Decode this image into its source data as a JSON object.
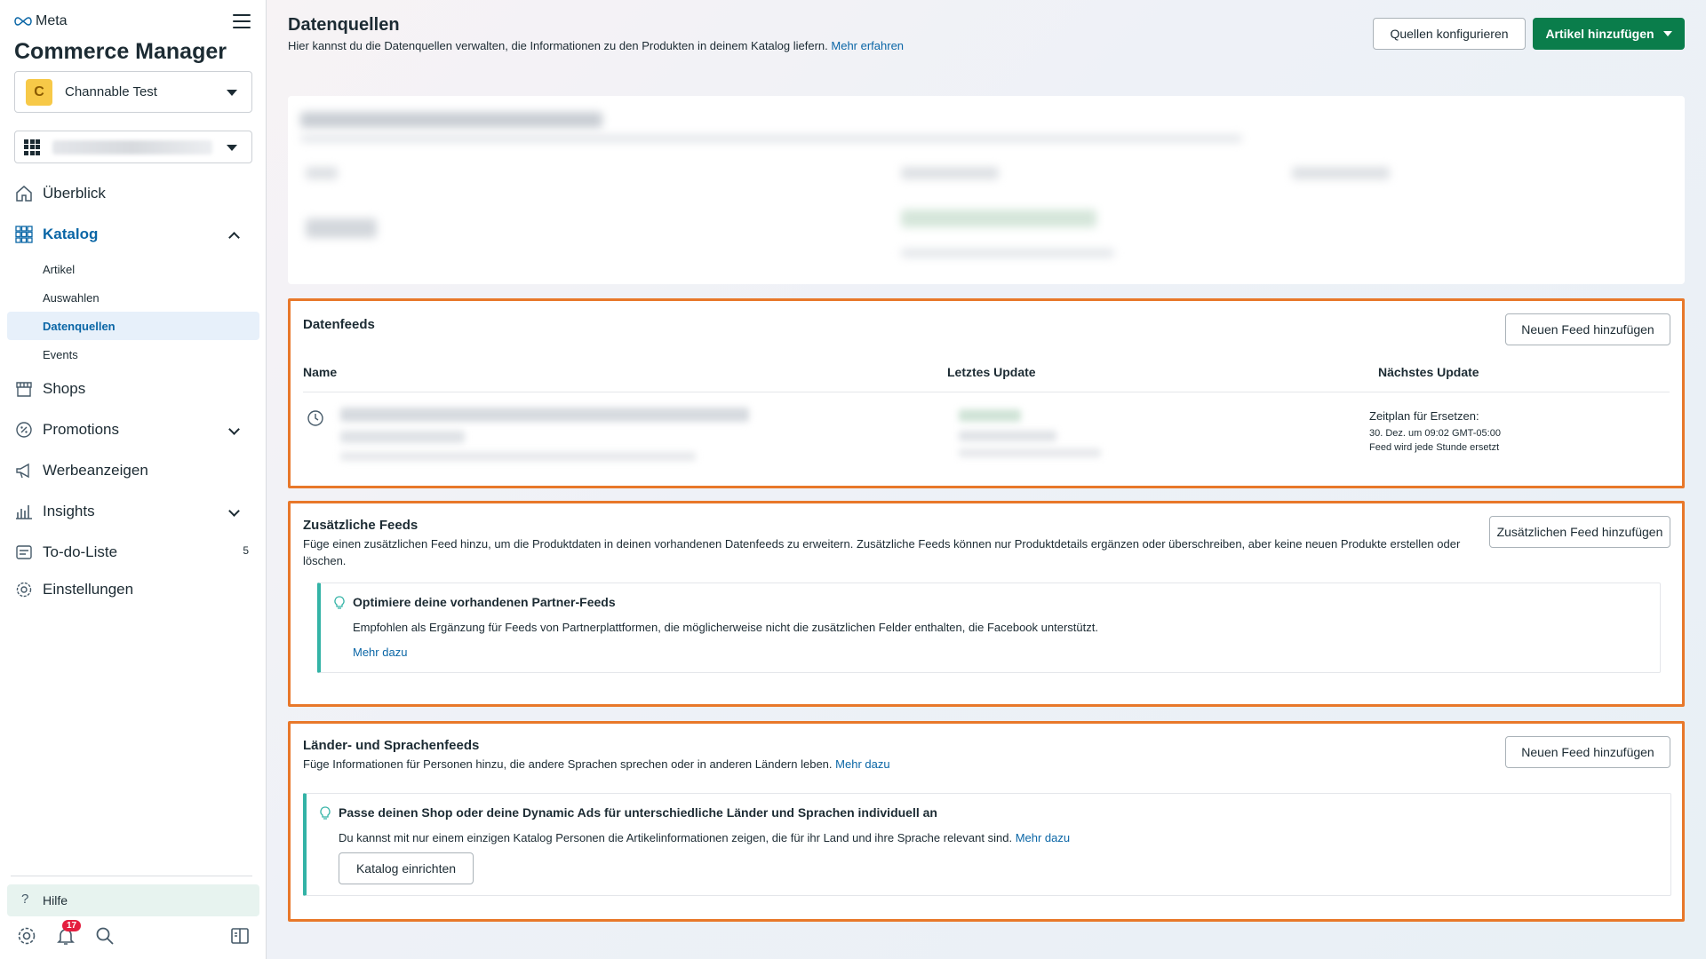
{
  "sidebar": {
    "brand": "Meta",
    "app_title": "Commerce Manager",
    "account": {
      "initial": "C",
      "name": "Channable Test"
    },
    "nav": {
      "overview": "Überblick",
      "catalog": "Katalog",
      "catalog_sub": [
        "Artikel",
        "Auswahlen",
        "Datenquellen",
        "Events"
      ],
      "shops": "Shops",
      "promotions": "Promotions",
      "ads": "Werbeanzeigen",
      "insights": "Insights",
      "todo": "To-do-Liste",
      "todo_count": "5",
      "settings": "Einstellungen"
    },
    "help": "Hilfe",
    "notifications_count": "17",
    "icons": [
      "home-icon",
      "catalog-grid-icon",
      "shop-icon",
      "promotions-icon",
      "megaphone-icon",
      "bar-chart-icon",
      "todo-icon",
      "gear-icon",
      "settings-icon",
      "bell-icon",
      "search-icon",
      "panel-toggle-icon"
    ]
  },
  "header": {
    "title": "Datenquellen",
    "subtitle": "Hier kannst du die Datenquellen verwalten, die Informationen zu den Produkten in deinem Katalog liefern.",
    "subtitle_link": "Mehr erfahren",
    "configure_button": "Quellen konfigurieren",
    "add_items_button": "Artikel hinzufügen"
  },
  "datafeeds": {
    "title": "Datenfeeds",
    "add_button": "Neuen Feed hinzufügen",
    "columns": [
      "Name",
      "Letztes Update",
      "Nächstes Update"
    ],
    "row": {
      "schedule_label": "Zeitplan für Ersetzen:",
      "schedule_time": "30. Dez. um 09:02 GMT-05:00",
      "schedule_freq": "Feed wird jede Stunde ersetzt"
    }
  },
  "supplementary": {
    "title": "Zusätzliche Feeds",
    "desc": "Füge einen zusätzlichen Feed hinzu, um die Produktdaten in deinen vorhandenen Datenfeeds zu erweitern. Zusätzliche Feeds können nur Produktdetails ergänzen oder überschreiben, aber keine neuen Produkte erstellen oder löschen.",
    "add_button": "Zusätzlichen Feed hinzufügen",
    "tip_title": "Optimiere deine vorhandenen Partner-Feeds",
    "tip_text": "Empfohlen als Ergänzung für Feeds von Partnerplattformen, die möglicherweise nicht die zusätzlichen Felder enthalten, die Facebook unterstützt.",
    "tip_link": "Mehr dazu"
  },
  "localized": {
    "title": "Länder- und Sprachenfeeds",
    "desc": "Füge Informationen für Personen hinzu, die andere Sprachen sprechen oder in anderen Ländern leben.",
    "desc_link": "Mehr dazu",
    "add_button": "Neuen Feed hinzufügen",
    "tip_title": "Passe deinen Shop oder deine Dynamic Ads für unterschiedliche Länder und Sprachen individuell an",
    "tip_text": "Du kannst mit nur einem einzigen Katalog Personen die Artikelinformationen zeigen, die für ihr Land und ihre Sprache relevant sind.",
    "tip_link": "Mehr dazu",
    "setup_button": "Katalog einrichten"
  },
  "colors": {
    "accent": "#0a66a6",
    "primary_button": "#0a7d4b",
    "highlight": "#e8782a",
    "tip_border": "#33b3a6"
  }
}
